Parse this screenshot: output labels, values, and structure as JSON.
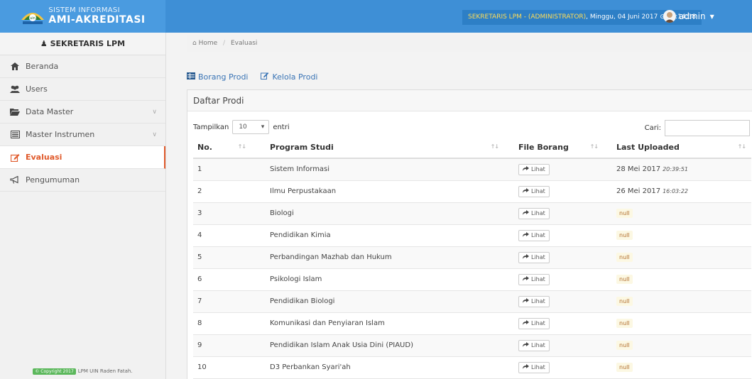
{
  "header": {
    "brand_sub": "SISTEM INFORMASI",
    "brand_main": "AMI-AKREDITASI",
    "status_role": "SEKRETARIS LPM - (ADMINISTRATOR)",
    "status_date": ", Minggu, 04 Juni 2017",
    "status_time": "15:14:38",
    "user_name": "admin",
    "accent": "#3e8fd6"
  },
  "sidebar": {
    "title": "SEKRETARIS LPM",
    "items": [
      {
        "label": "Beranda",
        "icon": "home-icon"
      },
      {
        "label": "Users",
        "icon": "users-icon"
      },
      {
        "label": "Data Master",
        "icon": "folder-open-icon"
      },
      {
        "label": "Master Instrumen",
        "icon": "list-icon"
      },
      {
        "label": "Evaluasi",
        "icon": "edit-icon",
        "active": true
      },
      {
        "label": "Pengumuman",
        "icon": "bullhorn-icon"
      }
    ],
    "footer_badge": "© Copyright 2017",
    "footer_text": "LPM UIN Raden Fatah."
  },
  "breadcrumb": {
    "home": "Home",
    "current": "Evaluasi"
  },
  "tabs": [
    {
      "label": "Borang Prodi"
    },
    {
      "label": "Kelola Prodi"
    }
  ],
  "panel": {
    "title": "Daftar Prodi",
    "length_prefix": "Tampilkan",
    "length_value": "10",
    "length_suffix": "entri",
    "search_label": "Cari:",
    "search_value": ""
  },
  "table": {
    "columns": [
      "No.",
      "Program Studi",
      "File Borang",
      "Last Uploaded"
    ],
    "button_label": "Lihat",
    "rows": [
      {
        "no": "1",
        "prodi": "Sistem Informasi",
        "date": "28 Mei 2017",
        "time": "20:39:51"
      },
      {
        "no": "2",
        "prodi": "Ilmu Perpustakaan",
        "date": "26 Mei 2017",
        "time": "16:03:22"
      },
      {
        "no": "3",
        "prodi": "Biologi",
        "null": "null"
      },
      {
        "no": "4",
        "prodi": "Pendidikan Kimia",
        "null": "null"
      },
      {
        "no": "5",
        "prodi": "Perbandingan Mazhab dan Hukum",
        "null": "null"
      },
      {
        "no": "6",
        "prodi": "Psikologi Islam",
        "null": "null"
      },
      {
        "no": "7",
        "prodi": "Pendidikan Biologi",
        "null": "null"
      },
      {
        "no": "8",
        "prodi": "Komunikasi dan Penyiaran Islam",
        "null": "null"
      },
      {
        "no": "9",
        "prodi": "Pendidikan Islam Anak Usia Dini (PIAUD)",
        "null": "null"
      },
      {
        "no": "10",
        "prodi": "D3 Perbankan Syari'ah",
        "null": "null"
      }
    ]
  }
}
